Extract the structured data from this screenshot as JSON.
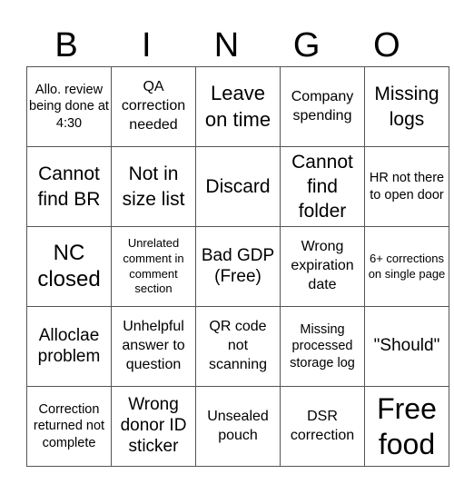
{
  "header": [
    "B",
    "I",
    "N",
    "G",
    "O"
  ],
  "rows": [
    [
      "Allo. review being done at 4:30",
      "QA correction needed",
      "Leave on time",
      "Company spending",
      "Missing logs"
    ],
    [
      "Cannot find BR",
      "Not in size list",
      "Discard",
      "Cannot find folder",
      "HR not there to open door"
    ],
    [
      "NC closed",
      "Unrelated comment in comment section",
      "Bad GDP (Free)",
      "Wrong expiration date",
      "6+ corrections on single page"
    ],
    [
      "Alloclae problem",
      "Unhelpful answer to question",
      "QR code not scanning",
      "Missing processed storage log",
      "\"Should\""
    ],
    [
      "Correction returned not complete",
      "Wrong donor ID sticker",
      "Unsealed pouch",
      "DSR correction",
      "Free food"
    ]
  ]
}
